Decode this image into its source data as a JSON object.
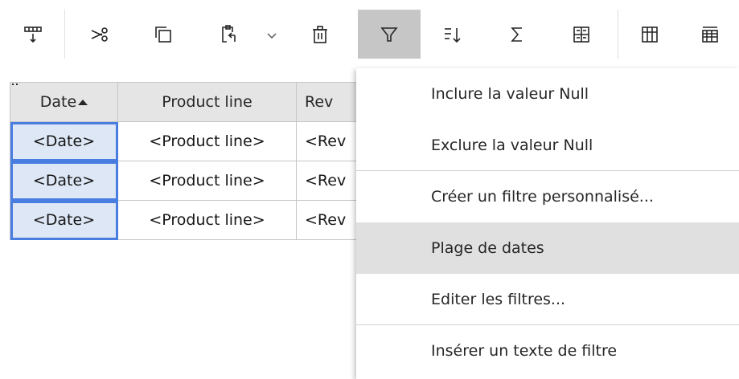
{
  "toolbar": {
    "buttons": [
      {
        "icon": "column-insert-icon"
      },
      {
        "icon": "cut-icon"
      },
      {
        "icon": "copy-icon"
      },
      {
        "icon": "paste-icon"
      },
      {
        "icon": "chevron-down-icon"
      },
      {
        "icon": "delete-icon"
      },
      {
        "icon": "filter-icon",
        "active": true
      },
      {
        "icon": "sort-icon"
      },
      {
        "icon": "summarize-icon"
      },
      {
        "icon": "crosstab-icon"
      },
      {
        "icon": "table-icon"
      },
      {
        "icon": "list-icon"
      }
    ]
  },
  "table": {
    "headers": {
      "date": "Date",
      "product_line": "Product line",
      "revenue": "Rev"
    },
    "rows": [
      {
        "date": "<Date>",
        "product_line": "<Product line>",
        "revenue": "<Rev"
      },
      {
        "date": "<Date>",
        "product_line": "<Product line>",
        "revenue": "<Rev"
      },
      {
        "date": "<Date>",
        "product_line": "<Product line>",
        "revenue": "<Rev"
      }
    ],
    "selection_color": "#4a7de0"
  },
  "filter_menu": {
    "items": [
      {
        "label": "Inclure la valeur Null"
      },
      {
        "label": "Exclure la valeur Null"
      },
      {
        "label": "Créer un filtre personnalisé..."
      },
      {
        "label": "Plage de dates",
        "highlighted": true
      },
      {
        "label": "Editer les filtres..."
      },
      {
        "label": "Insérer un texte de filtre"
      }
    ]
  },
  "colors": {
    "active_button_bg": "#c6c6c6",
    "menu_highlight_bg": "#e0e0e0",
    "header_bg": "#e5e5e5"
  }
}
